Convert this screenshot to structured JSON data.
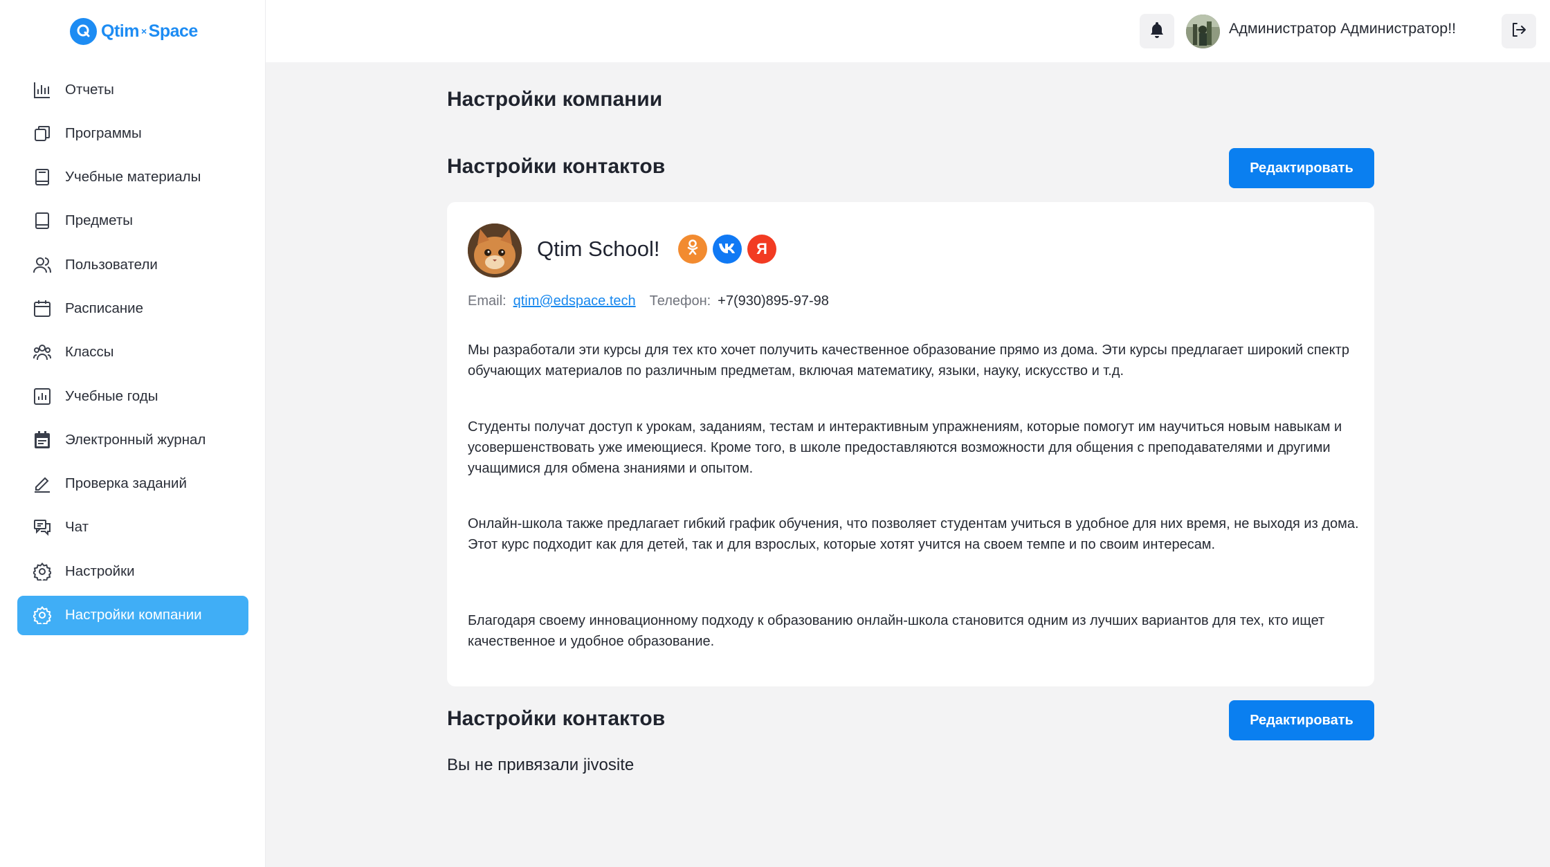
{
  "brand": {
    "name_left": "Qtim",
    "name_sep": "×",
    "name_right": "Space",
    "color": "#1d8cf3"
  },
  "sidebar": {
    "items": [
      {
        "label": "Отчеты",
        "icon": "bar-chart-icon"
      },
      {
        "label": "Программы",
        "icon": "copy-icon"
      },
      {
        "label": "Учебные материалы",
        "icon": "book-icon"
      },
      {
        "label": "Предметы",
        "icon": "book-icon"
      },
      {
        "label": "Пользователи",
        "icon": "users-icon"
      },
      {
        "label": "Расписание",
        "icon": "calendar-icon"
      },
      {
        "label": "Классы",
        "icon": "group-icon"
      },
      {
        "label": "Учебные годы",
        "icon": "chart-box-icon"
      },
      {
        "label": "Электронный журнал",
        "icon": "calendar-filled-icon"
      },
      {
        "label": "Проверка заданий",
        "icon": "pencil-icon"
      },
      {
        "label": "Чат",
        "icon": "chat-icon"
      },
      {
        "label": "Настройки",
        "icon": "gear-icon"
      },
      {
        "label": "Настройки компании",
        "icon": "gear-icon",
        "active": true
      }
    ],
    "active_color": "#40aef6"
  },
  "header": {
    "user_name": "Администратор Администратор!!"
  },
  "main": {
    "page_title": "Настройки компании",
    "contacts_section": {
      "title": "Настройки контактов",
      "edit_label": "Редактировать",
      "card": {
        "name": "Qtim School!",
        "socials": {
          "ok": "ok-icon",
          "vk": "vk-icon",
          "yandex": "Я"
        },
        "email_label": "Email:",
        "email": "qtim@edspace.tech",
        "phone_label": "Телефон:",
        "phone": "+7(930)895-97-98",
        "paragraphs": [
          "Мы разработали эти курсы для тех кто хочет получить качественное образование прямо из дома. Эти курсы предлагает широкий спектр обучающих материалов по различным предметам, включая математику, языки, науку, искусство и т.д.",
          "Студенты получат доступ к урокам, заданиям, тестам и интерактивным упражнениям, которые помогут им научиться новым навыкам и усовершенствовать уже имеющиеся. Кроме того, в школе предоставляются возможности для общения с преподавателями и другими учащимися для обмена знаниями и опытом.",
          "Онлайн-школа также предлагает гибкий график обучения, что позволяет студентам учиться в удобное для них время, не выходя из дома. Этот курс подходит как для детей, так и для взрослых, которые хотят учится на своем темпе и по своим интересам.",
          "Благодаря своему инновационному подходу к образованию онлайн-школа становится одним из лучших вариантов для тех, кто ищет качественное и удобное образование."
        ]
      }
    },
    "jivo_section": {
      "title": "Настройки контактов",
      "edit_label": "Редактировать",
      "status_text": "Вы не привязали jivosite"
    },
    "accent_color": "#0a7ff0"
  }
}
